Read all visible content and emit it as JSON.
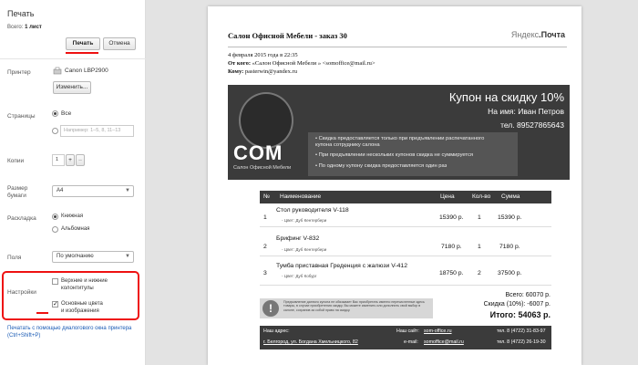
{
  "panel": {
    "title": "Печать",
    "count_label": "Всего:",
    "count_value": "1 лист",
    "print_button": "Печать",
    "cancel_button": "Отмена",
    "printer": {
      "label": "Принтер",
      "name": "Canon LBP2900",
      "change_button": "Изменить..."
    },
    "pages": {
      "label": "Страницы",
      "all_label": "Все",
      "range_placeholder": "Например: 1–5, 8, 11–13"
    },
    "copies": {
      "label": "Копии",
      "value": "1",
      "plus": "+",
      "minus": "–"
    },
    "paper": {
      "label_line1": "Размер",
      "label_line2": "бумаги",
      "value": "A4"
    },
    "layout": {
      "label": "Раскладка",
      "portrait": "Книжная",
      "landscape": "Альбомная"
    },
    "margins": {
      "label": "Поля",
      "value": "По умолчанию"
    },
    "settings": {
      "label": "Настройки",
      "headers_line1": "Верхние и нижние",
      "headers_line2": "колонтитулы",
      "bg_line1": "Основные цвета",
      "bg_line2": "и изображения"
    },
    "system_link_line1": "Печатать с помощью диалогового окна принтера",
    "system_link_line2": "(Ctrl+Shift+P)"
  },
  "email": {
    "subject": "Салон Офисной Мебели - заказ 30",
    "logo_a": "Яндекс",
    "logo_b": ".Почта",
    "date": "4 февраля 2015 года в 22:35",
    "from_label": "От кого:",
    "from_value": "«Салон Офисной Мебели » <somoffice@mail.ru>",
    "to_label": "Кому:",
    "to_value": "pasterwin@yandex.ru"
  },
  "coupon": {
    "title": "Купон на скидку 10%",
    "name": "На имя: Иван Петров",
    "phone": "тел. 89527865643",
    "logo_text": "COM",
    "logo_sub": "Салон Офисной Мебели",
    "bullets": [
      "• Скидка предоставляется только при предъявлении распечатанного",
      "  купона сотруднику салона",
      "• При предъявлении нескольких купонов скидка не суммируется",
      "• По одному купону скидка предоставляется один раз"
    ]
  },
  "order": {
    "headers": [
      "№",
      "Наименование",
      "Цена",
      "Кол-во",
      "Сумма"
    ],
    "rows": [
      {
        "n": "1",
        "name": "Стол руководителя V-118",
        "color": "- Цвет: Дуб Кентербери",
        "price": "15390 р.",
        "qty": "1",
        "sum": "15390 р."
      },
      {
        "n": "2",
        "name": "Брифинг V-832",
        "color": "- Цвет: Дуб Кентербери",
        "price": "7180 р.",
        "qty": "1",
        "sum": "7180 р."
      },
      {
        "n": "3",
        "name": "Тумба приставная Греденция с жалюзи V-412",
        "color": "- Цвет: Дуб Кобург",
        "price": "18750 р.",
        "qty": "2",
        "sum": "37500 р."
      }
    ],
    "notice_icon": "!",
    "notice": "Предъявление данного купона не обязывает Вас приобретать именно перечисленные здесь товары, в случае приобретения скидку. Вы можете изменить или дополнить свой выбор в салоне, сохранив за собой право на скидку.",
    "total_label": "Всего: 60070 р.",
    "discount_label": "Скидка (10%): -6007 р.",
    "grand_label": "Итого: 54063 р."
  },
  "footer": {
    "addr_label": "Наш адрес:",
    "addr": "г. Белгород, ул. Богдана Хмельницкого, 82",
    "site_label": "Наш сайт:",
    "site": "som-office.ru",
    "email_label": "e-mail:",
    "email": "somoffice@mail.ru",
    "phone1": "тел. 8 (4722) 31-83-97",
    "phone2": "тел. 8 (4722) 26-19-30"
  }
}
